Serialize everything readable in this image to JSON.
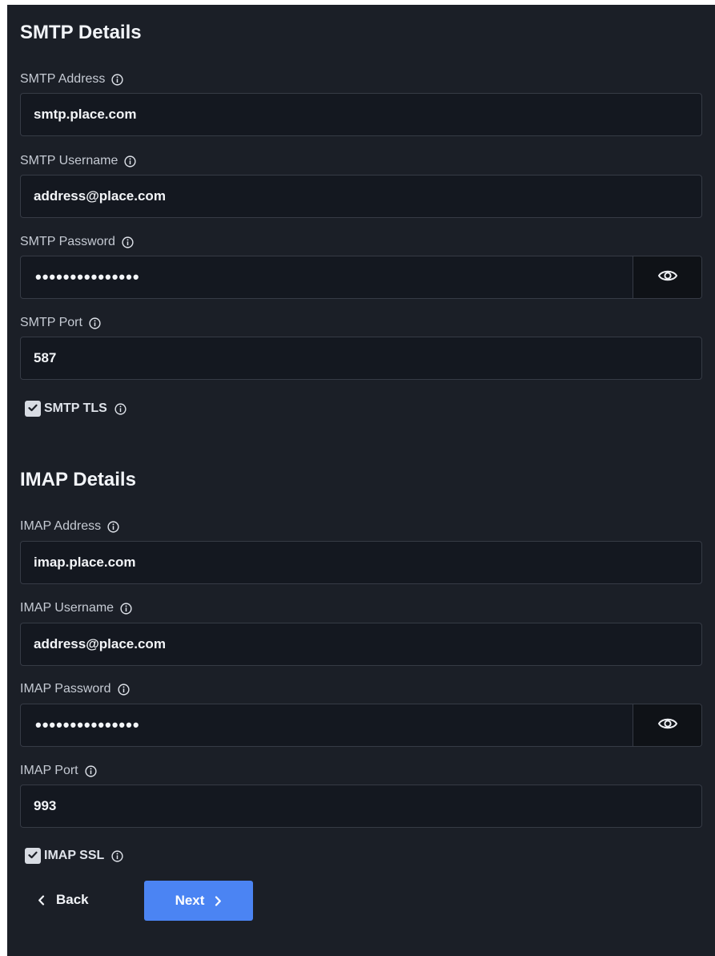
{
  "smtp": {
    "title": "SMTP Details",
    "address": {
      "label": "SMTP Address",
      "value": "smtp.place.com"
    },
    "username": {
      "label": "SMTP Username",
      "value": "address@place.com"
    },
    "password": {
      "label": "SMTP Password",
      "value": "•••••••••••••••"
    },
    "port": {
      "label": "SMTP Port",
      "value": "587"
    },
    "tls": {
      "label": "SMTP TLS",
      "checked": true
    }
  },
  "imap": {
    "title": "IMAP Details",
    "address": {
      "label": "IMAP Address",
      "value": "imap.place.com"
    },
    "username": {
      "label": "IMAP Username",
      "value": "address@place.com"
    },
    "password": {
      "label": "IMAP Password",
      "value": "•••••••••••••••"
    },
    "port": {
      "label": "IMAP Port",
      "value": "993"
    },
    "ssl": {
      "label": "IMAP SSL",
      "checked": true
    }
  },
  "nav": {
    "back_label": "Back",
    "next_label": "Next"
  },
  "icons": {
    "info": "info-icon",
    "eye": "eye-icon",
    "check": "check-icon",
    "chevron_left": "chevron-left-icon",
    "chevron_right": "chevron-right-icon"
  },
  "colors": {
    "background": "#1b1f27",
    "input_bg": "#141820",
    "border": "#363b45",
    "primary": "#4b84f3"
  }
}
